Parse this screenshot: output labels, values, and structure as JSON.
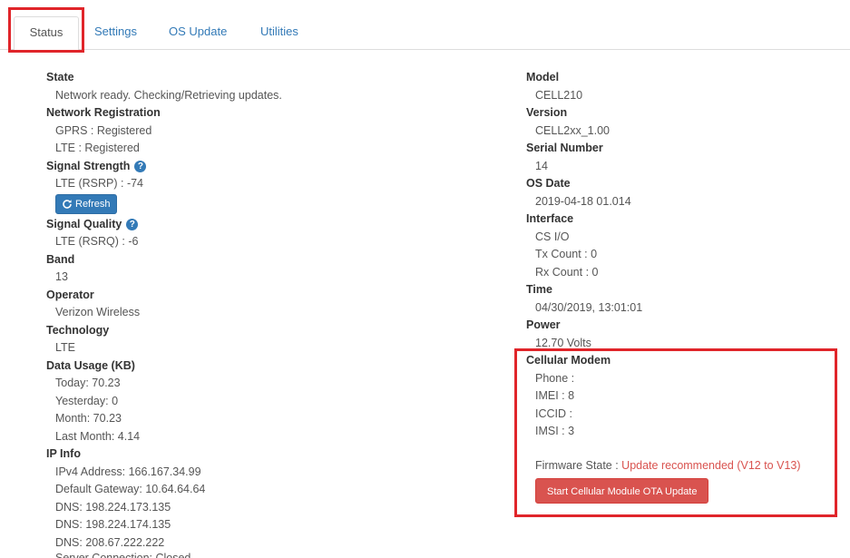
{
  "tabs": [
    "Status",
    "Settings",
    "OS Update",
    "Utilities"
  ],
  "left": {
    "state_label": "State",
    "state_value": "Network ready. Checking/Retrieving updates.",
    "netreg_label": "Network Registration",
    "netreg_gprs": "GPRS : Registered",
    "netreg_lte": "LTE : Registered",
    "signal_strength_label": "Signal Strength",
    "signal_strength_value": "LTE (RSRP) : -74",
    "refresh_label": "Refresh",
    "signal_quality_label": "Signal Quality",
    "signal_quality_value": "LTE (RSRQ) : -6",
    "band_label": "Band",
    "band_value": "13",
    "operator_label": "Operator",
    "operator_value": "Verizon Wireless",
    "technology_label": "Technology",
    "technology_value": "LTE",
    "data_usage_label": "Data Usage (KB)",
    "data_today": "Today: 70.23",
    "data_yesterday": "Yesterday: 0",
    "data_month": "Month: 70.23",
    "data_last_month": "Last Month: 4.14",
    "ip_info_label": "IP Info",
    "ipv4": "IPv4 Address: 166.167.34.99",
    "gateway": "Default Gateway: 10.64.64.64",
    "dns1": "DNS: 198.224.173.135",
    "dns2": "DNS: 198.224.174.135",
    "dns3": "DNS: 208.67.222.222",
    "server_connection": "Server Connection: Closed"
  },
  "right": {
    "model_label": "Model",
    "model_value": "CELL210",
    "version_label": "Version",
    "version_value": "CELL2xx_1.00",
    "serial_label": "Serial Number",
    "serial_value": "14",
    "os_date_label": "OS Date",
    "os_date_value": "2019-04-18 01.014",
    "interface_label": "Interface",
    "interface_value": "CS I/O",
    "tx_count": "Tx Count : 0",
    "rx_count": "Rx Count : 0",
    "time_label": "Time",
    "time_value": "04/30/2019, 13:01:01",
    "power_label": "Power",
    "power_value": "12.70 Volts",
    "modem_label": "Cellular Modem",
    "phone": "Phone :",
    "imei": "IMEI : 8",
    "iccid": "ICCID :",
    "imsi": "IMSI : 3",
    "firmware_state_label": "Firmware State :",
    "firmware_state_value": "Update recommended (V12 to V13)",
    "ota_button": "Start Cellular Module OTA Update"
  },
  "icons": {
    "help": "question-circle-icon",
    "refresh": "refresh-icon"
  },
  "colors": {
    "link": "#337ab7",
    "danger": "#d9534f",
    "highlight": "#e0252a"
  }
}
